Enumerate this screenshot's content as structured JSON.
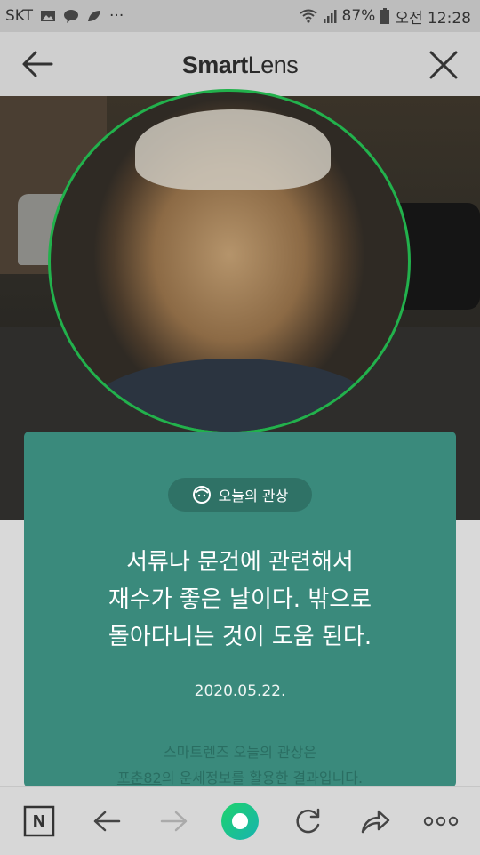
{
  "status_bar": {
    "carrier": "SKT",
    "more": "···",
    "battery": "87%",
    "time": "오전 12:28",
    "icons": [
      "image-icon",
      "chat-bubble-icon",
      "leaf-icon",
      "wifi-icon",
      "signal-icon",
      "battery-icon"
    ]
  },
  "header": {
    "title_bold": "Smart",
    "title_light": "Lens",
    "back_icon": "back-arrow-icon",
    "close_icon": "close-icon"
  },
  "photo": {
    "face_circle_color": "#22b14c"
  },
  "card": {
    "color": "#3a8a7c",
    "badge_label": "오늘의 관상",
    "badge_icon": "face-icon",
    "fortune_lines": [
      "서류나 문건에 관련해서",
      "재수가 좋은 날이다. 밖으로",
      "돌아다니는 것이 도움 된다."
    ],
    "date": "2020.05.22.",
    "credit_line1": "스마트렌즈 오늘의 관상은",
    "credit_link": "포춘82",
    "credit_line2_rest": "의 운세정보를 활용한 결과입니다."
  },
  "bottom_bar": {
    "items": [
      "naver-n-icon",
      "back-icon",
      "forward-icon",
      "green-dot-icon",
      "refresh-icon",
      "share-icon",
      "more-icon"
    ],
    "n_label": "N",
    "more_label": "ooo"
  }
}
